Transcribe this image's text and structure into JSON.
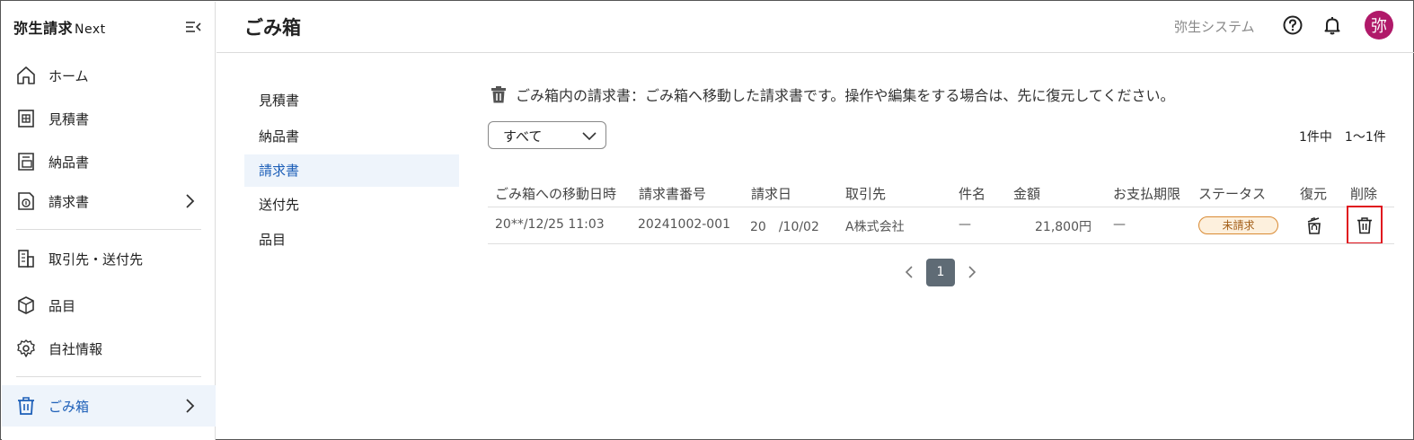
{
  "app": {
    "logo_main": "弥生請求",
    "logo_sub": "Next"
  },
  "sidebar": {
    "items": [
      {
        "label": "ホーム",
        "icon": "home-icon"
      },
      {
        "label": "見積書",
        "icon": "estimate-document-icon"
      },
      {
        "label": "納品書",
        "icon": "delivery-document-icon"
      },
      {
        "label": "請求書",
        "icon": "invoice-document-icon"
      },
      {
        "label": "取引先・送付先",
        "icon": "building-icon"
      },
      {
        "label": "品目",
        "icon": "box-icon"
      },
      {
        "label": "自社情報",
        "icon": "gear-icon"
      },
      {
        "label": "ごみ箱",
        "icon": "trash-icon"
      }
    ],
    "active_item": "ごみ箱"
  },
  "header": {
    "title": "ごみ箱",
    "company": "弥生システム",
    "avatar_text": "弥"
  },
  "subnav": {
    "items": [
      "見積書",
      "納品書",
      "請求書",
      "送付先",
      "品目"
    ],
    "active": "請求書"
  },
  "main": {
    "info_text": "ごみ箱内の請求書：ごみ箱へ移動した請求書です。操作や編集をする場合は、先に復元してください。",
    "filter_value": "すべて",
    "count_total": "1件中",
    "count_range": "1〜1件",
    "columns": [
      "ごみ箱への移動日時",
      "請求書番号",
      "請求日",
      "取引先",
      "件名",
      "金額",
      "お支払期限",
      "ステータス",
      "復元",
      "削除"
    ],
    "rows": [
      {
        "moved_at": "20**/12/25 11:03",
        "invoice_number": "20241002-001",
        "invoice_date": "20　/10/02",
        "client": "A株式会社",
        "subject": "—",
        "amount": "21,800円",
        "due_date": "—",
        "status": "未請求"
      }
    ],
    "pagination": {
      "current": "1"
    }
  },
  "colors": {
    "accent": "#1d5fb8",
    "active_bg": "#eef4fb",
    "avatar_bg": "#b01969",
    "status_border": "#d98a33",
    "status_bg": "#fdf0dd",
    "highlight": "#e0141e"
  }
}
